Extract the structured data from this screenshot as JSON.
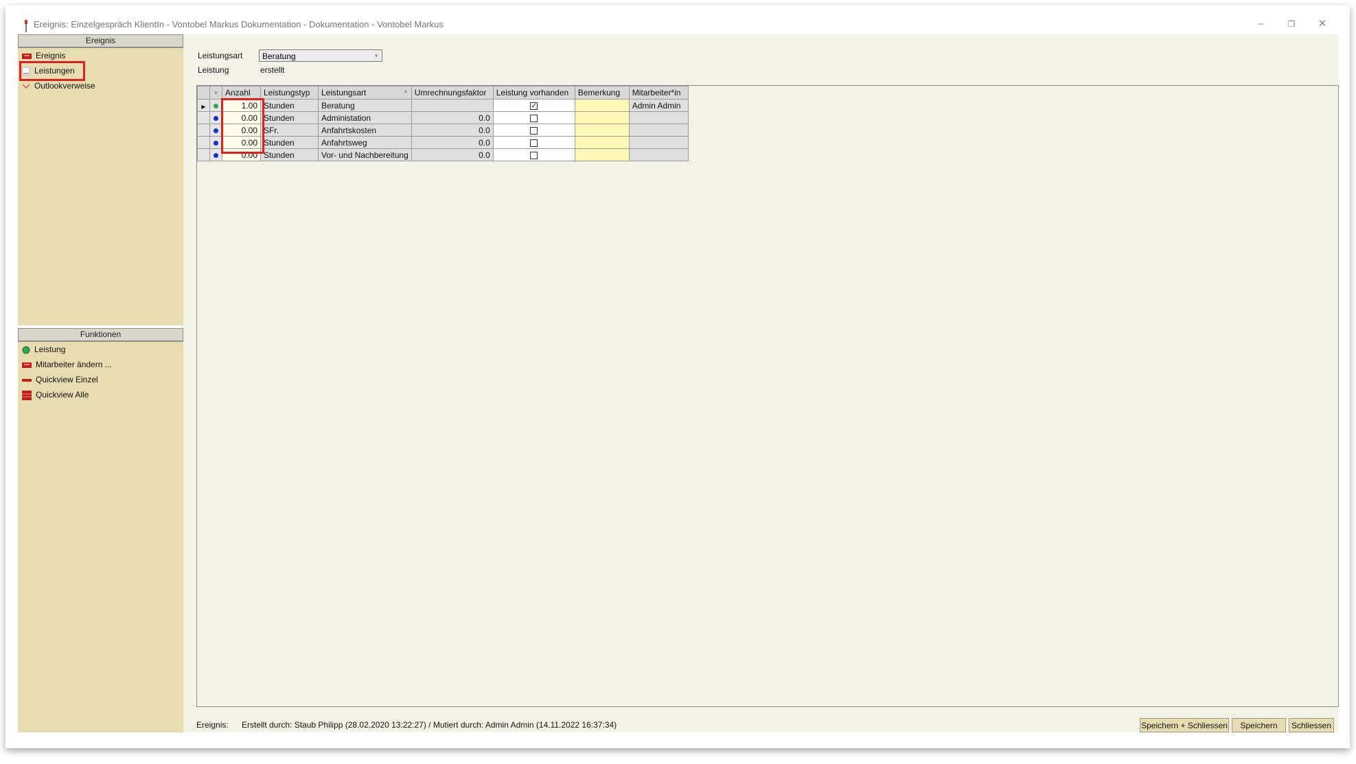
{
  "window": {
    "title": "Ereignis: Einzelgespräch KlientIn - Vontobel Markus Dokumentation - Dokumentation - Vontobel Markus",
    "controls": [
      "minimize-icon",
      "restore-icon",
      "close-icon"
    ]
  },
  "sidebar": {
    "ereignis_header": "Ereignis",
    "ereignis_items": [
      {
        "label": "Ereignis",
        "icon": "red-tray-icon"
      },
      {
        "label": "Leistungen",
        "icon": "document-icon",
        "highlighted": true
      },
      {
        "label": "Outlookverweise",
        "icon": "outlook-icon"
      }
    ],
    "funktionen_header": "Funktionen",
    "funktionen_items": [
      {
        "label": "Leistung",
        "icon": "green-circle-icon"
      },
      {
        "label": "Mitarbeiter ändern ...",
        "icon": "red-tray-icon"
      },
      {
        "label": "Quickview Einzel",
        "icon": "red-bar-icon"
      },
      {
        "label": "Quickview Alle",
        "icon": "red-list-icon"
      }
    ]
  },
  "form": {
    "leistungsart_label": "Leistungsart",
    "leistungsart_value": "Beratung",
    "leistung_label": "Leistung",
    "leistung_value": "erstellt"
  },
  "grid": {
    "columns": [
      "Anzahl",
      "Leistungstyp",
      "Leistungsart",
      "Umrechnungsfaktor",
      "Leistung vorhanden",
      "Bemerkung",
      "Mitarbeiter*in"
    ],
    "rows": [
      {
        "current": true,
        "dot": "#2fa84f",
        "anzahl": "1.00",
        "typ": "Stunden",
        "art": "Beratung",
        "faktor": "",
        "vorhanden": true,
        "bemerkung": "",
        "mitarbeiter": "Admin Admin"
      },
      {
        "current": false,
        "dot": "#1630c8",
        "anzahl": "0.00",
        "typ": "Stunden",
        "art": "Administation",
        "faktor": "0.0",
        "vorhanden": false,
        "bemerkung": "",
        "mitarbeiter": ""
      },
      {
        "current": false,
        "dot": "#1630c8",
        "anzahl": "0.00",
        "typ": "SFr.",
        "art": "Anfahrtskosten",
        "faktor": "0.0",
        "vorhanden": false,
        "bemerkung": "",
        "mitarbeiter": ""
      },
      {
        "current": false,
        "dot": "#1630c8",
        "anzahl": "0.00",
        "typ": "Stunden",
        "art": "Anfahrtsweg",
        "faktor": "0.0",
        "vorhanden": false,
        "bemerkung": "",
        "mitarbeiter": ""
      },
      {
        "current": false,
        "dot": "#1630c8",
        "anzahl": "0.00",
        "typ": "Stunden",
        "art": "Vor- und Nachbereitung",
        "faktor": "0.0",
        "vorhanden": false,
        "bemerkung": "",
        "mitarbeiter": ""
      }
    ]
  },
  "statusbar": {
    "label": "Ereignis:",
    "text": "Erstellt durch: Staub Philipp (28.02.2020 13:22:27) / Mutiert durch: Admin Admin (14.11.2022 16:37:34)"
  },
  "buttons": {
    "save_close": "Speichern + Schliessen",
    "save": "Speichern",
    "close": "Schliessen"
  },
  "colors": {
    "sidebar_bg": "#e7ddb0",
    "highlight_frame": "#e0201c",
    "current_dot": "#2fa84f",
    "row_dot": "#1630c8"
  }
}
